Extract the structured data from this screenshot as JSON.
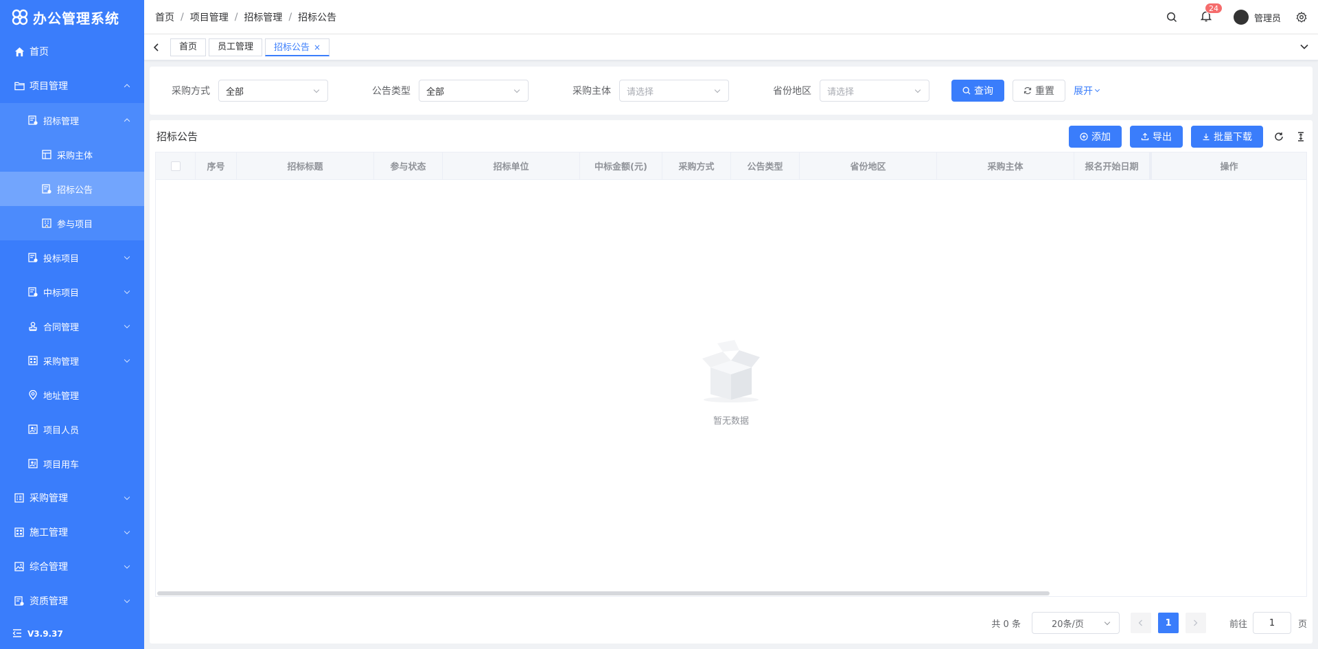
{
  "app": {
    "title": "办公管理系统",
    "version": "V3.9.37"
  },
  "sidebar": {
    "items": [
      {
        "label": "首页",
        "icon": "home-icon"
      },
      {
        "label": "项目管理",
        "icon": "folder-icon"
      },
      {
        "label": "招标管理",
        "icon": "doc-icon"
      },
      {
        "label": "采购主体",
        "icon": "table-icon"
      },
      {
        "label": "招标公告",
        "icon": "doc-icon"
      },
      {
        "label": "参与项目",
        "icon": "building-icon"
      },
      {
        "label": "投标项目",
        "icon": "doc-icon"
      },
      {
        "label": "中标项目",
        "icon": "doc-icon"
      },
      {
        "label": "合同管理",
        "icon": "stamp-icon"
      },
      {
        "label": "采购管理",
        "icon": "grid-icon"
      },
      {
        "label": "地址管理",
        "icon": "location-icon"
      },
      {
        "label": "项目人员",
        "icon": "person-icon"
      },
      {
        "label": "项目用车",
        "icon": "person-icon"
      },
      {
        "label": "采购管理",
        "icon": "list-icon"
      },
      {
        "label": "施工管理",
        "icon": "grid-icon"
      },
      {
        "label": "综合管理",
        "icon": "image-icon"
      },
      {
        "label": "资质管理",
        "icon": "doc-icon"
      }
    ]
  },
  "header": {
    "breadcrumb": [
      "首页",
      "项目管理",
      "招标管理",
      "招标公告"
    ],
    "separator": "/",
    "notification_count": "24",
    "username": "管理员"
  },
  "tabs": [
    {
      "label": "首页"
    },
    {
      "label": "员工管理"
    },
    {
      "label": "招标公告",
      "close": "×"
    }
  ],
  "search": {
    "fields": [
      {
        "label": "采购方式",
        "value": "全部"
      },
      {
        "label": "公告类型",
        "value": "全部"
      },
      {
        "label": "采购主体",
        "placeholder": "请选择"
      },
      {
        "label": "省份地区",
        "placeholder": "请选择"
      }
    ],
    "query_label": "查询",
    "reset_label": "重置",
    "expand_label": "展开"
  },
  "table": {
    "title": "招标公告",
    "add_label": "添加",
    "export_label": "导出",
    "batch_download_label": "批量下载",
    "columns": [
      "序号",
      "招标标题",
      "参与状态",
      "招标单位",
      "中标金额(元)",
      "采购方式",
      "公告类型",
      "省份地区",
      "采购主体",
      "报名开始日期",
      "操作"
    ],
    "empty_text": "暂无数据"
  },
  "pagination": {
    "total": "共 0 条",
    "page_size": "20条/页",
    "current_page": "1",
    "goto_prefix": "前往",
    "goto_value": "1",
    "goto_suffix": "页"
  },
  "colors": {
    "primary": "#3a7dfb",
    "sidebar_active": "#72a5fd",
    "badge": "#f56c6c"
  }
}
